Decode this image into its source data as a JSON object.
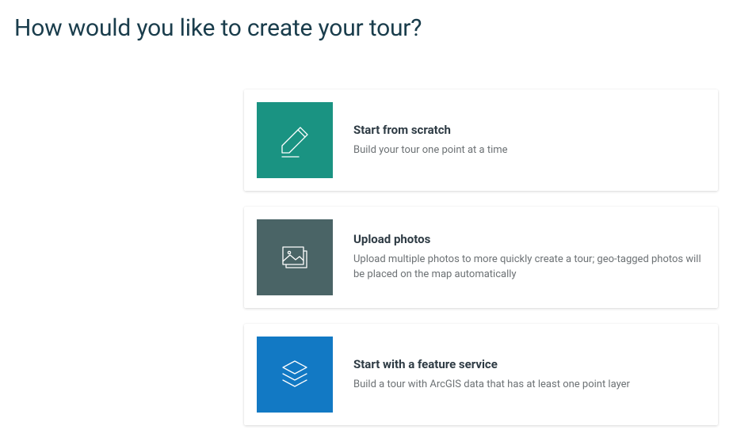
{
  "header": {
    "title": "How would you like to create your tour?"
  },
  "options": [
    {
      "icon": "pencil-icon",
      "title": "Start from scratch",
      "description": "Build your tour one point at a time"
    },
    {
      "icon": "photo-stack-icon",
      "title": "Upload photos",
      "description": "Upload multiple photos to more quickly create a tour; geo-tagged photos will be placed on the map automatically"
    },
    {
      "icon": "layers-icon",
      "title": "Start with a feature service",
      "description": "Build a tour with ArcGIS data that has at least one point layer"
    }
  ],
  "colors": {
    "scratch": "#1a9382",
    "upload": "#4a6466",
    "feature": "#1279c4",
    "title_text": "#1a3d4c"
  }
}
